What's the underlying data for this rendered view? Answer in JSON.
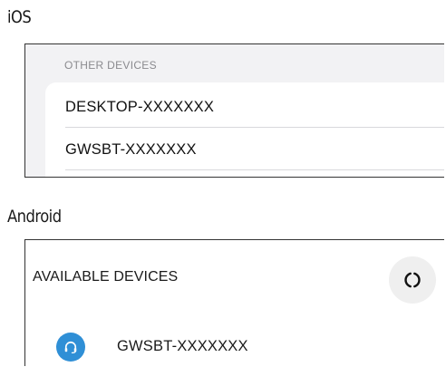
{
  "ios": {
    "heading": "iOS",
    "section_header": "OTHER DEVICES",
    "devices": [
      {
        "name": "DESKTOP-XXXXXXX"
      },
      {
        "name": "GWSBT-XXXXXXX"
      }
    ]
  },
  "android": {
    "heading": "Android",
    "section_header": "AVAILABLE DEVICES",
    "refresh_icon": "refresh-icon",
    "devices": [
      {
        "name": "GWSBT-XXXXXXX",
        "icon": "headset-icon",
        "icon_color": "#2f8fd6"
      }
    ]
  },
  "colors": {
    "ios_background": "#f2f2f4",
    "ios_section_header": "#8a8a8e",
    "android_icon_bg": "#2f8fd6",
    "refresh_button_bg": "#efefef"
  }
}
